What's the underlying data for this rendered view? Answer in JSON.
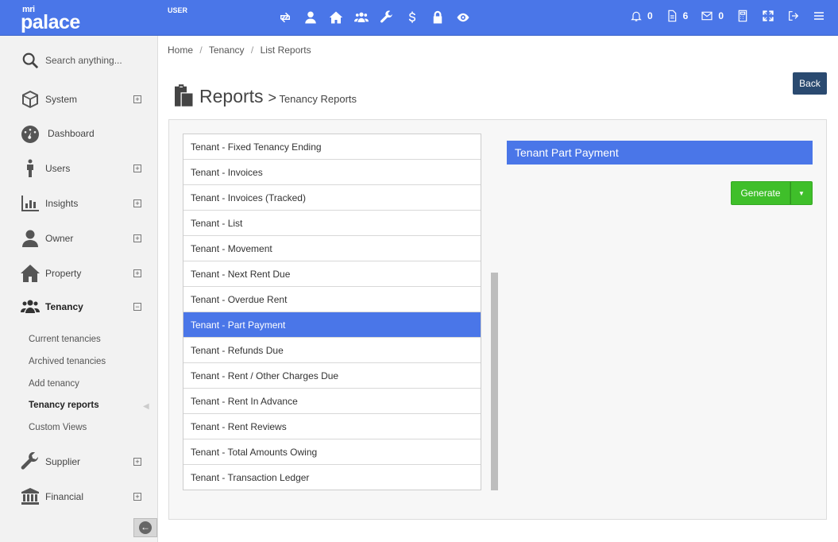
{
  "brand": {
    "mri": "mri",
    "name": "palace"
  },
  "topbar": {
    "user_label": "USER",
    "icons": [
      "sync-icon",
      "person-icon",
      "home-icon",
      "group-icon",
      "wrench-icon",
      "dollar-icon",
      "lock-icon",
      "eye-icon"
    ],
    "notifications": {
      "bell": "0",
      "documents": "6",
      "mail": "0"
    }
  },
  "sidebar": {
    "search_placeholder": "Search anything...",
    "items": [
      {
        "label": "System"
      },
      {
        "label": "Dashboard"
      },
      {
        "label": "Users"
      },
      {
        "label": "Insights"
      },
      {
        "label": "Owner"
      },
      {
        "label": "Property"
      },
      {
        "label": "Tenancy"
      },
      {
        "label": "Supplier"
      },
      {
        "label": "Financial"
      }
    ],
    "tenancy_sub": [
      {
        "label": "Current tenancies"
      },
      {
        "label": "Archived tenancies"
      },
      {
        "label": "Add tenancy"
      },
      {
        "label": "Tenancy reports"
      },
      {
        "label": "Custom Views"
      }
    ]
  },
  "breadcrumb": {
    "home": "Home",
    "tenancy": "Tenancy",
    "current": "List Reports"
  },
  "page": {
    "title": "Reports",
    "subtitle": "Tenancy Reports",
    "arrow": ">",
    "back_label": "Back"
  },
  "reports": [
    "Tenant - Fixed Tenancy Ending",
    "Tenant - Invoices",
    "Tenant - Invoices (Tracked)",
    "Tenant - List",
    "Tenant - Movement",
    "Tenant - Next Rent Due",
    "Tenant - Overdue Rent",
    "Tenant - Part Payment",
    "Tenant - Refunds Due",
    "Tenant - Rent / Other Charges Due",
    "Tenant - Rent In Advance",
    "Tenant - Rent Reviews",
    "Tenant - Total Amounts Owing",
    "Tenant - Transaction Ledger"
  ],
  "selected_report": "Tenant Part Payment",
  "generate_label": "Generate",
  "colors": {
    "accent": "#4a76e8",
    "generate": "#3fbf2a",
    "back": "#2a4a70"
  }
}
